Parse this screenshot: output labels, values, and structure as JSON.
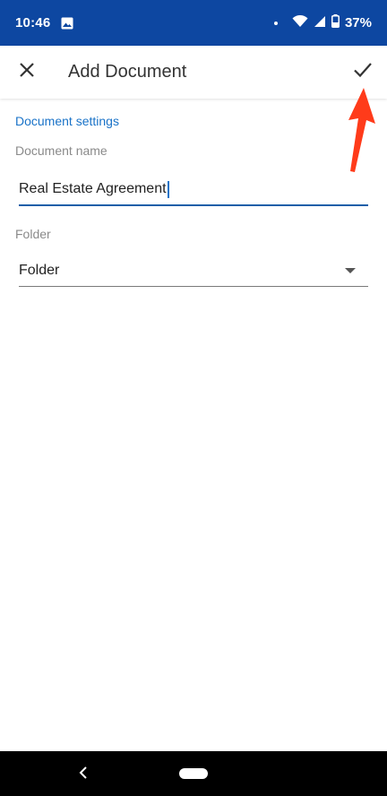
{
  "status_bar": {
    "time": "10:46",
    "battery": "37%",
    "icons": [
      "photo-icon",
      "dot-icon",
      "wifi-icon",
      "cell-signal-icon",
      "battery-icon"
    ]
  },
  "app_bar": {
    "title": "Add Document",
    "close_icon": "close-icon",
    "confirm_icon": "check-icon"
  },
  "form": {
    "section_title": "Document settings",
    "document_name_label": "Document name",
    "document_name_value": "Real Estate Agreement",
    "folder_label": "Folder",
    "folder_selected": "Folder"
  },
  "nav_bar": {
    "back_icon": "back-icon",
    "home_icon": "home-pill-icon"
  },
  "colors": {
    "status_bar_bg": "#0d47a1",
    "accent": "#1a73c8",
    "annotation_arrow": "#ff3b1a"
  }
}
